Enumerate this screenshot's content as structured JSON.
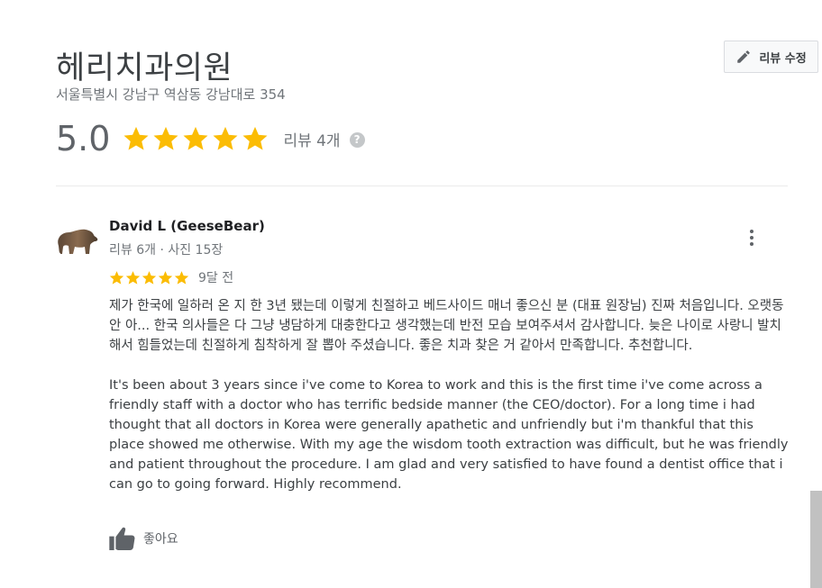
{
  "place": {
    "name": "헤리치과의원",
    "address": "서울특별시 강남구 역삼동 강남대로 354",
    "rating": "5.0",
    "stars": 5,
    "review_count_label": "리뷰 4개",
    "help_icon_glyph": "?"
  },
  "edit_button": {
    "label": "리뷰 수정",
    "icon": "pencil-icon"
  },
  "review": {
    "reviewer_name": "David L (GeeseBear)",
    "reviewer_meta": "리뷰 6개 · 사진 15장",
    "stars": 5,
    "date": "9달 전",
    "text_ko": "제가 한국에 일하러 온 지 한 3년 됐는데 이렇게 친절하고 베드사이드 매너 좋으신 분 (대표 원장님) 진짜 처음입니다. 오랫동안 아... 한국 의사들은 다 그냥 냉담하게 대충한다고 생각했는데 반전 모습 보여주셔서 감사합니다. 늦은 나이로 사랑니 발치해서 힘들었는데 친절하게 침착하게 잘 뽑아 주셨습니다. 좋은 치과 찾은 거 같아서 만족합니다. 추천합니다.",
    "text_en": "It's been about 3 years since i've come to Korea to work and this is the first time i've come across a friendly staff with a doctor who has terrific bedside manner (the CEO/doctor). For a long time i had thought that all doctors in Korea were generally apathetic and unfriendly but i'm thankful that this place showed me otherwise. With my age the wisdom tooth extraction was difficult, but he was friendly and patient throughout the procedure. I am glad and very satisfied to have found a dentist office that i can go to going forward. Highly recommend.",
    "like_label": "좋아요",
    "avatar_icon": "bear-avatar-icon",
    "more_icon": "more-vert-icon",
    "like_icon": "thumbs-up-icon"
  },
  "colors": {
    "star": "#fbbc04",
    "primary_text": "#202124",
    "secondary_text": "#70757a"
  }
}
